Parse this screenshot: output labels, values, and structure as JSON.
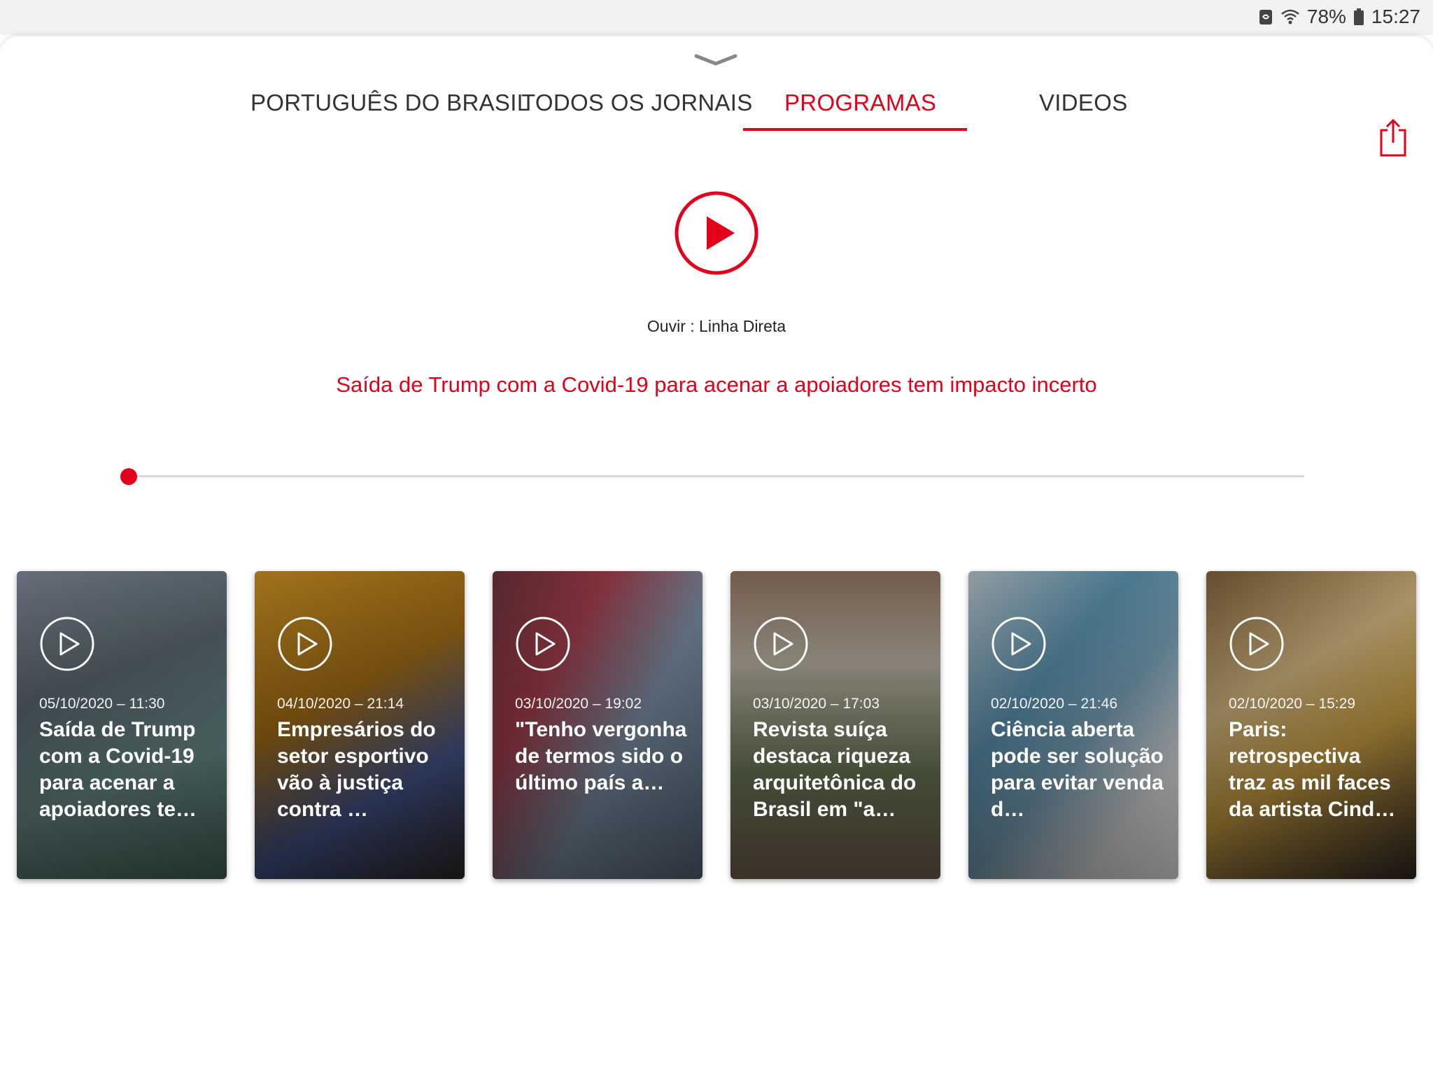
{
  "status_bar": {
    "battery_percent": "78%",
    "time": "15:27",
    "icons": [
      "sync-icon",
      "wifi-icon",
      "battery-icon"
    ]
  },
  "tabs": [
    {
      "label": "PORTUGUÊS DO BRASIL",
      "active": false
    },
    {
      "label": "TODOS OS JORNAIS",
      "active": false
    },
    {
      "label": "PROGRAMAS",
      "active": true
    },
    {
      "label": "VIDEOS",
      "active": false
    }
  ],
  "player": {
    "listen_label": "Ouvir : Linha Direta",
    "headline": "Saída de Trump com a Covid-19 para acenar a apoiadores tem impacto incerto",
    "progress": 0.0
  },
  "cards": [
    {
      "date": "05/10/2020 – 11:30",
      "title": "Saída de Trump com a Covid-19 para acenar a apoiadores te…"
    },
    {
      "date": "04/10/2020 – 21:14",
      "title": "Empresários do setor esportivo vão à justiça contra …"
    },
    {
      "date": "03/10/2020 – 19:02",
      "title": "\"Tenho vergonha de termos sido o último país a…"
    },
    {
      "date": "03/10/2020 – 17:03",
      "title": "Revista suíça destaca riqueza arquitetônica do Brasil em \"a…"
    },
    {
      "date": "02/10/2020 – 21:46",
      "title": "Ciência aberta pode ser solução para evitar venda d…"
    },
    {
      "date": "02/10/2020 – 15:29",
      "title": "Paris: retrospectiva traz as mil faces da artista Cind…"
    }
  ],
  "colors": {
    "accent": "#e2001a",
    "tab_text": "#333333",
    "track": "#d8d8d8"
  }
}
